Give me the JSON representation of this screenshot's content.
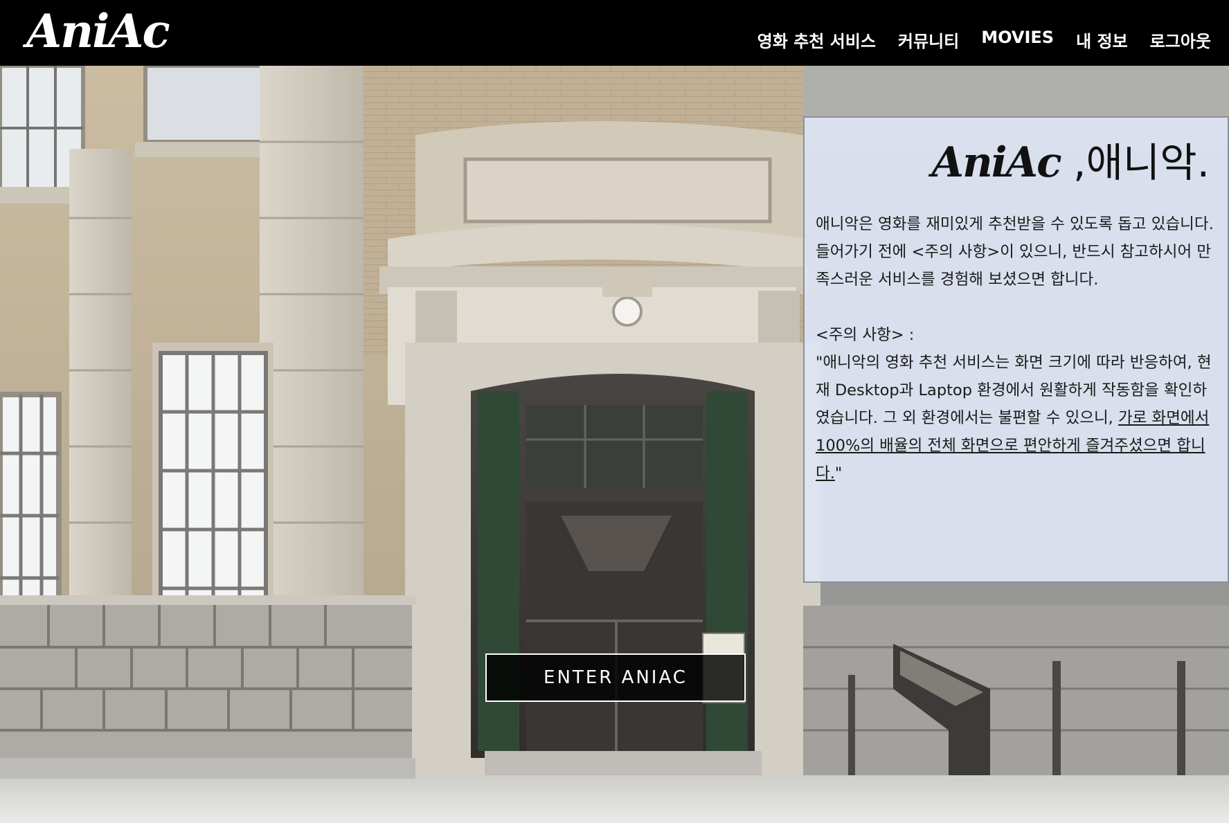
{
  "header": {
    "logo": "AniAc",
    "nav": [
      {
        "label": "영화 추천 서비스"
      },
      {
        "label": "커뮤니티"
      },
      {
        "label": "MOVIES"
      },
      {
        "label": "내 정보"
      },
      {
        "label": "로그아웃"
      }
    ]
  },
  "info": {
    "title_brand": "AniAc",
    "title_suffix": " ,애니악.",
    "paragraph1": " 애니악은 영화를 재미있게 추천받을 수 있도록 돕고 있습니다.",
    "paragraph2": "들어가기 전에 <주의 사항>이 있으니, 반드시 참고하시어 만족스러운 서비스를 경험해 보셨으면 합니다.",
    "notice_heading": "<주의 사항> :",
    "notice_text": " \"애니악의 영화 추천 서비스는 화면 크기에 따라 반응하여, 현재 Desktop과 Laptop 환경에서 원활하게 작동함을 확인하였습니다. 그 외 환경에서는 불편할 수 있으니, ",
    "notice_underlined": "가로 화면에서 100%의 배율의 전체 화면으로 편안하게 즐겨주셨으면 합니다.",
    "notice_close": "\""
  },
  "enter_button": {
    "label": "ENTER ANIAC"
  },
  "colors": {
    "navbar_bg": "#000000",
    "nav_text": "#ffffff",
    "panel_bg": "#dee4f2",
    "door_green": "#1f3a26"
  }
}
